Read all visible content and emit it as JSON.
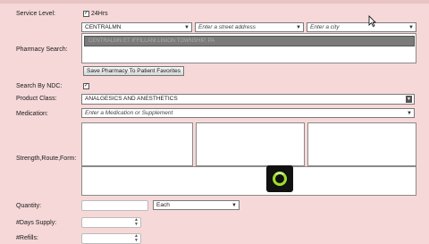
{
  "labels": {
    "service_level": "Service Level:",
    "pharmacy_search": "Pharmacy Search:",
    "search_by_ndc": "Search By NDC:",
    "product_class": "Product Class:",
    "medication": "Medication:",
    "strength_route_form": "Strength,Route,Form:",
    "quantity": "Quantity:",
    "days_supply": "#Days Supply:",
    "refills": "#Refills:"
  },
  "service_level": {
    "checkbox_label": "24Hrs",
    "checked": true
  },
  "pharmacy": {
    "name_value": "CENTRALMN",
    "street_placeholder": "Enter a street address",
    "city_placeholder": "Enter a city",
    "result_text": "CENTRALMN ET IFFILLANI LINION TOWNSHIP, PA",
    "save_button": "Save Pharmacy To Patient Favorites"
  },
  "ndc": {
    "checked": true
  },
  "product_class": {
    "value": "ANALGESICS AND ANESTHETICS"
  },
  "medication": {
    "placeholder": "Enter a Medication or Supplement"
  },
  "quantity": {
    "unit_value": "Each"
  }
}
